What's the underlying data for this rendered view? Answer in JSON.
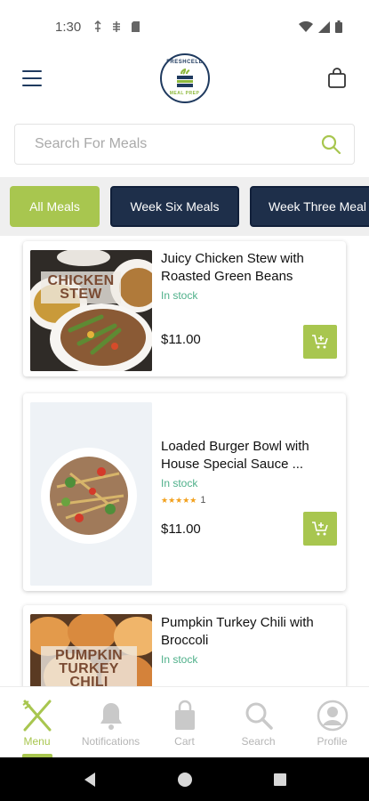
{
  "status": {
    "time": "1:30"
  },
  "header": {
    "logo_top": "FRESHCELL",
    "logo_bottom": "MEAL PREP"
  },
  "search": {
    "placeholder": "Search For Meals"
  },
  "categories": [
    {
      "label": "All Meals",
      "active": true
    },
    {
      "label": "Week Six Meals",
      "active": false
    },
    {
      "label": "Week Three Meal",
      "active": false
    }
  ],
  "meals": [
    {
      "name": "Juicy Chicken Stew with Roasted Green Beans",
      "stock": "In stock",
      "price": "$11.00",
      "image_label": "CHICKEN STEW"
    },
    {
      "name": "Loaded Burger Bowl with House Special Sauce ...",
      "stock": "In stock",
      "rating": 5,
      "rating_count": "1",
      "price": "$11.00"
    },
    {
      "name": "Pumpkin Turkey Chili with Broccoli",
      "stock": "In stock",
      "image_label": "PUMPKIN TURKEY CHILI"
    }
  ],
  "bottom_nav": [
    {
      "label": "Menu",
      "icon": "fork-knife-icon",
      "active": true
    },
    {
      "label": "Notifications",
      "icon": "bell-icon",
      "active": false
    },
    {
      "label": "Cart",
      "icon": "shopping-bag-icon",
      "active": false
    },
    {
      "label": "Search",
      "icon": "search-icon",
      "active": false
    },
    {
      "label": "Profile",
      "icon": "profile-icon",
      "active": false
    }
  ],
  "colors": {
    "accent": "#a8c64f",
    "navy": "#1e2f4a",
    "stock": "#4fb08a",
    "star": "#f2a01c"
  }
}
